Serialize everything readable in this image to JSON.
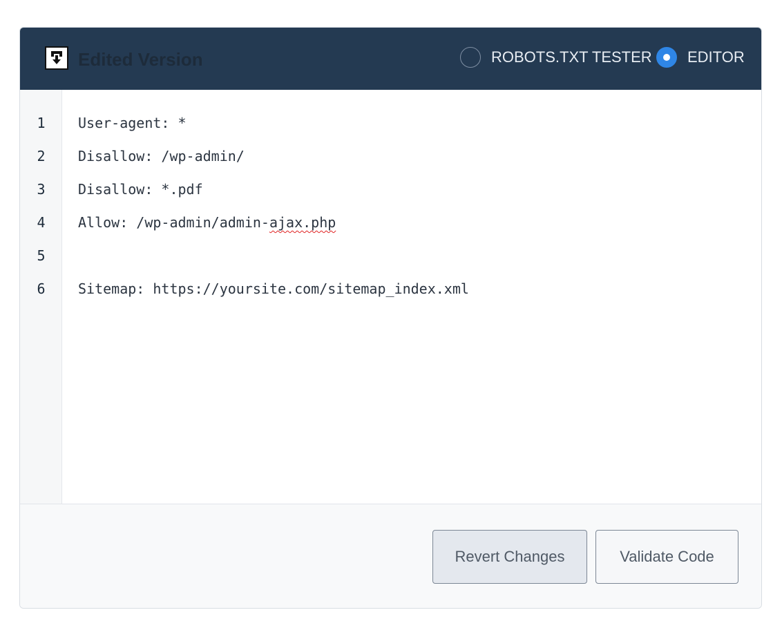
{
  "header": {
    "icon": "download-arrow-icon",
    "title": "Edited Version",
    "modes": [
      {
        "label": "ROBOTS.TXT TESTER",
        "selected": false
      },
      {
        "label": "EDITOR",
        "selected": true
      }
    ]
  },
  "editor": {
    "lines": [
      {
        "number": "1",
        "text": "User-agent: *"
      },
      {
        "number": "2",
        "text": "Disallow: /wp-admin/"
      },
      {
        "number": "3",
        "text": "Disallow: *.pdf"
      },
      {
        "number": "4",
        "text_before": "Allow: /wp-admin/admin-",
        "text_flagged": "ajax.php"
      },
      {
        "number": "5",
        "text": ""
      },
      {
        "number": "6",
        "text": "Sitemap: https://yoursite.com/sitemap_index.xml"
      }
    ]
  },
  "footer": {
    "revert_label": "Revert Changes",
    "validate_label": "Validate Code"
  },
  "colors": {
    "header_bg": "#243a52",
    "accent": "#2f86e6",
    "spellcheck_underline": "#e02020"
  }
}
